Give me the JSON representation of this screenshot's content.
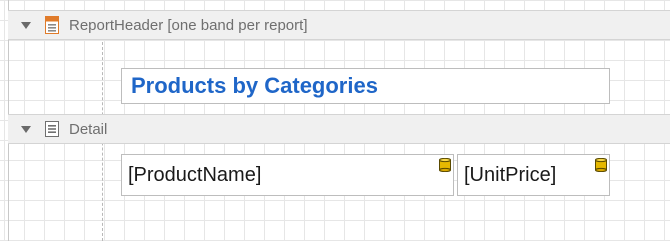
{
  "report_header_band": {
    "label": "ReportHeader [one band per report]",
    "icon": "report-header-band-icon",
    "title_control": {
      "text": "Products by Categories",
      "color": "#1f66c8"
    }
  },
  "detail_band": {
    "label": "Detail",
    "icon": "detail-band-icon",
    "fields": [
      {
        "text": "[ProductName]",
        "icon": "database-field-icon"
      },
      {
        "text": "[UnitPrice]",
        "icon": "database-field-icon"
      }
    ]
  },
  "colors": {
    "band_background": "#f0f0f0",
    "grid": "#e6e6e6",
    "title_blue": "#1f66c8",
    "band_icon_orange": "#e07b2a",
    "database_gold": "#e6b800"
  }
}
